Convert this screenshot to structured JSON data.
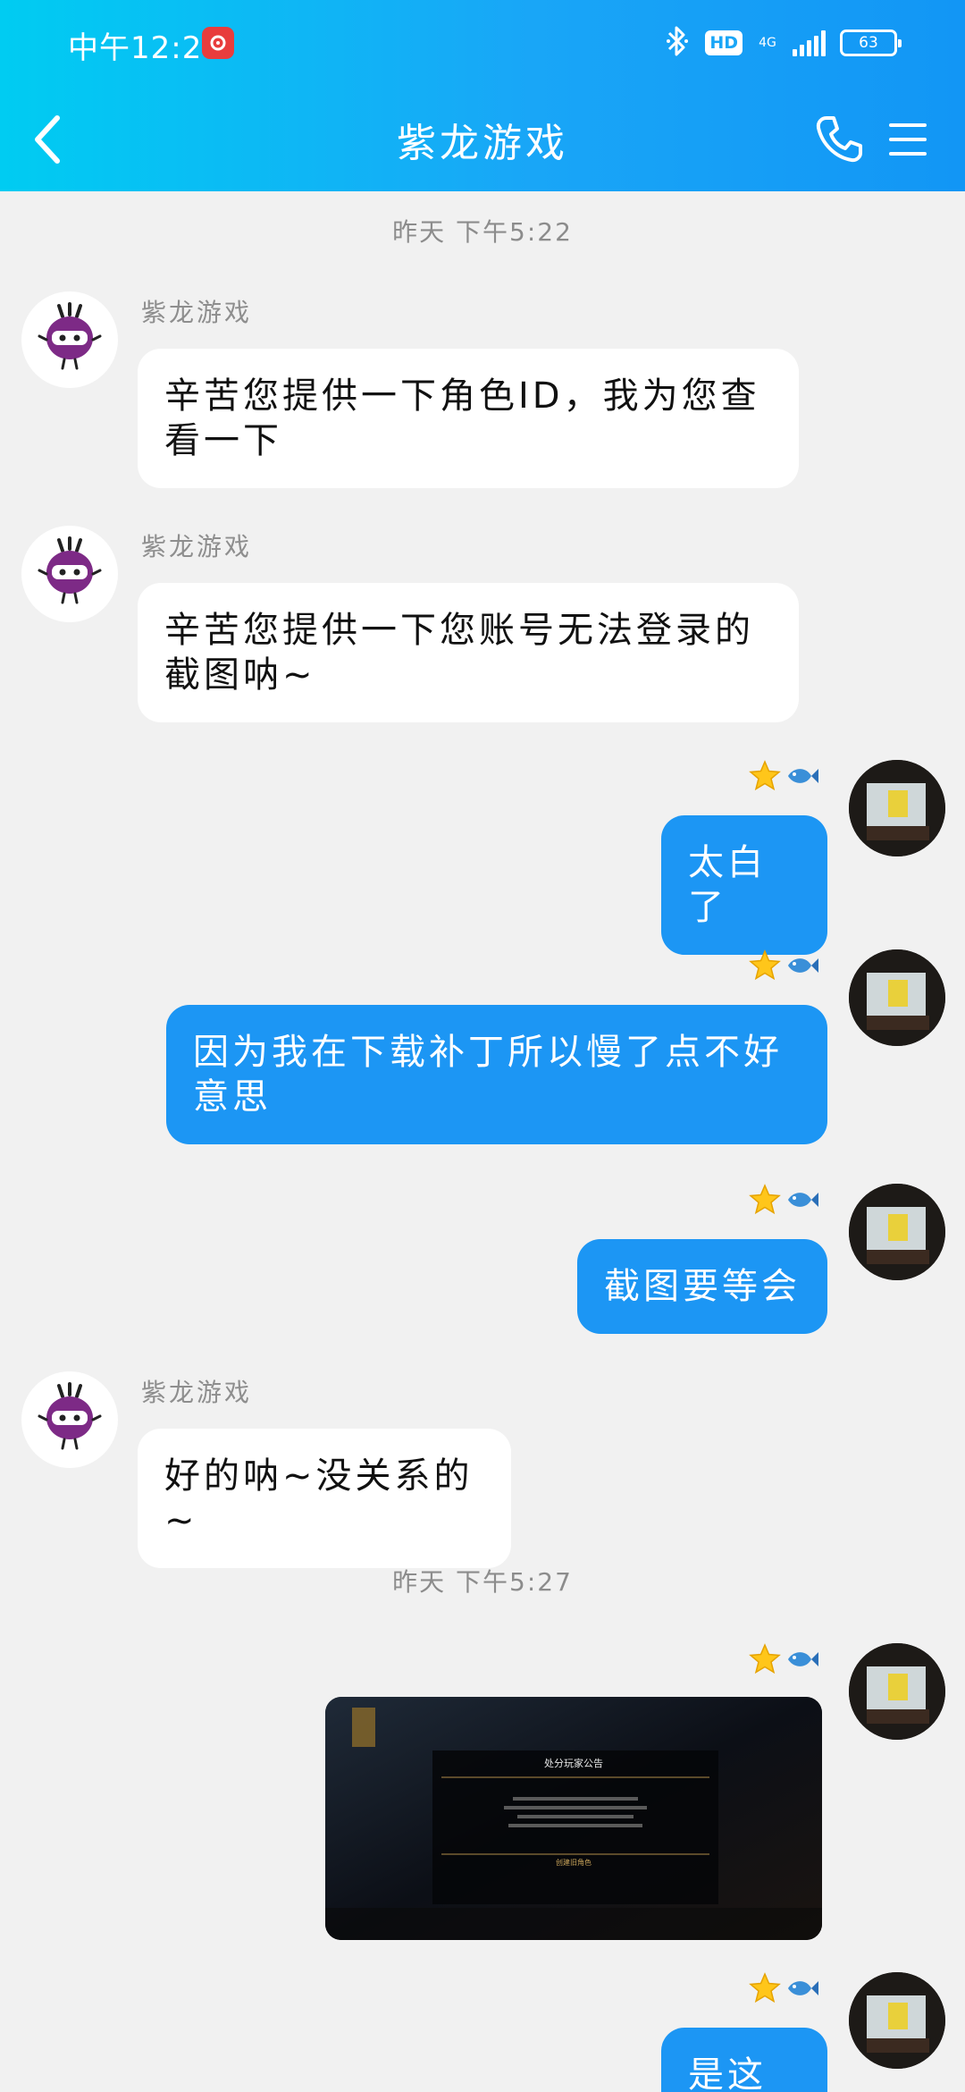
{
  "status_bar": {
    "time": "中午12:29",
    "hd": "HD",
    "network": "4G",
    "battery": "63"
  },
  "header": {
    "back_icon": "chevron-left-icon",
    "title": "紫龙游戏",
    "phone_icon": "phone-icon",
    "menu_icon": "hamburger-menu-icon"
  },
  "colors": {
    "header_start": "#00ccf2",
    "header_end": "#1296f5",
    "outgoing_bubble": "#1c96f4",
    "incoming_bubble": "#ffffff",
    "background": "#f1f1f1"
  },
  "messages": {
    "ts1": "昨天 下午5:22",
    "m1": {
      "sender": "紫龙游戏",
      "text": "辛苦您提供一下角色ID，我为您查看一下"
    },
    "m2": {
      "sender": "紫龙游戏",
      "text": "辛苦您提供一下您账号无法登录的截图呐~"
    },
    "m3": {
      "text": "太白了"
    },
    "m4": {
      "text": "因为我在下载补丁所以慢了点不好意思"
    },
    "m5": {
      "text": "截图要等会"
    },
    "m6": {
      "sender": "紫龙游戏",
      "text": "好的呐~没关系的~"
    },
    "ts2": "昨天 下午5:27",
    "m7": {
      "image_title": "处分玩家公告",
      "image_link": "创建旧角色"
    },
    "m8": {
      "text": "是这个"
    }
  }
}
